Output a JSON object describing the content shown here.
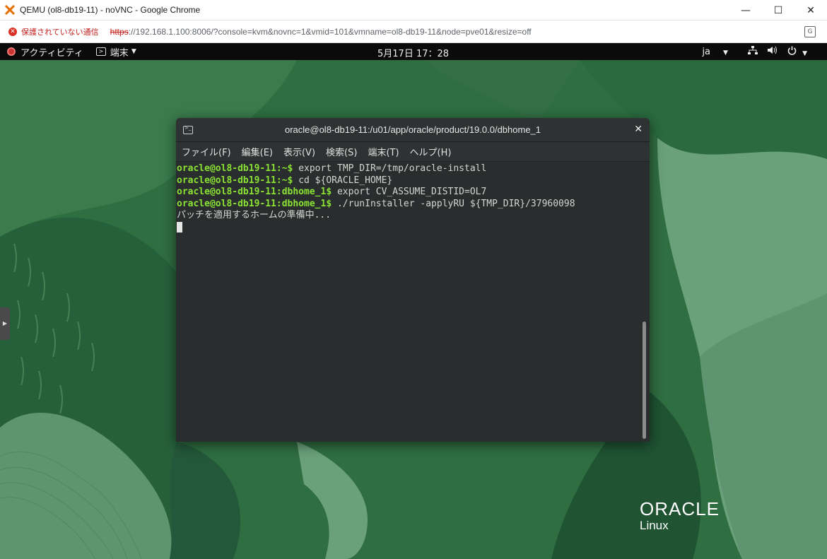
{
  "browser": {
    "window_title": "QEMU (ol8-db19-11) - noVNC - Google Chrome",
    "security_label": "保護されていない通信",
    "url_scheme": "https",
    "url_rest": "://192.168.1.100:8006/?console=kvm&novnc=1&vmid=101&vmname=ol8-db19-11&node=pve01&resize=off",
    "controls": {
      "minimize": "—",
      "maximize": "☐",
      "close": "✕"
    }
  },
  "gnome": {
    "activities": "アクティビティ",
    "app_menu": "端末",
    "clock": "5月17日  17：28",
    "lang": "ja"
  },
  "terminal": {
    "title": "oracle@ol8-db19-11:/u01/app/oracle/product/19.0.0/dbhome_1",
    "menu": [
      "ファイル(F)",
      "編集(E)",
      "表示(V)",
      "検索(S)",
      "端末(T)",
      "ヘルプ(H)"
    ],
    "lines": [
      {
        "prompt": "oracle@ol8-db19-11:~$",
        "cmd": " export TMP_DIR=/tmp/oracle-install"
      },
      {
        "prompt": "oracle@ol8-db19-11:~$",
        "cmd": " cd ${ORACLE_HOME}"
      },
      {
        "prompt": "oracle@ol8-db19-11:dbhome_1$",
        "cmd": " export CV_ASSUME_DISTID=OL7"
      },
      {
        "prompt": "oracle@ol8-db19-11:dbhome_1$",
        "cmd": " ./runInstaller -applyRU ${TMP_DIR}/37960098"
      }
    ],
    "output": "パッチを適用するホームの準備中..."
  },
  "branding": {
    "company": "ORACLE",
    "product": "Linux"
  },
  "colors": {
    "prompt": "#8ae234",
    "desktop": "#2b6a3e",
    "terminal_bg": "#2a2d2e"
  },
  "icons": [
    "proxmox-x-icon",
    "insecure-icon",
    "translate-icon",
    "activities-icon",
    "terminal-icon",
    "network-icon",
    "volume-icon",
    "power-icon",
    "close-icon"
  ]
}
